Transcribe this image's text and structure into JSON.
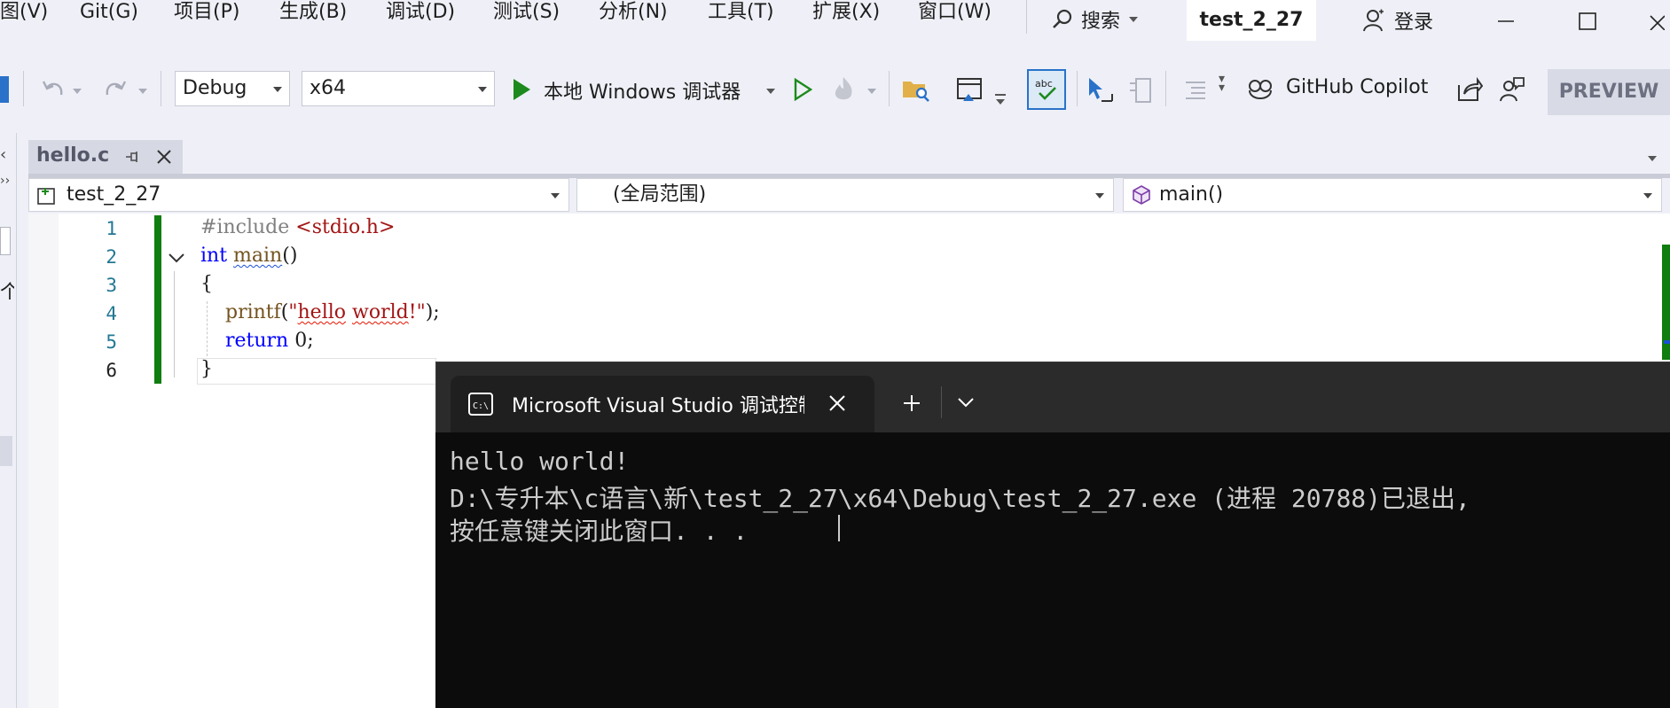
{
  "menu": {
    "items": [
      "图(V)",
      "Git(G)",
      "项目(P)",
      "生成(B)",
      "调试(D)",
      "测试(S)",
      "分析(N)",
      "工具(T)",
      "扩展(X)",
      "窗口(W)"
    ],
    "search_label": "搜索",
    "solution_title": "test_2_27",
    "login_label": "登录"
  },
  "toolbar": {
    "config": "Debug",
    "platform": "x64",
    "debugger_label": "本地 Windows 调试器",
    "copilot_label": "GitHub Copilot",
    "preview_label": "PREVIEW"
  },
  "tabs": [
    {
      "label": "hello.c",
      "active": true
    }
  ],
  "navbar": {
    "project": "test_2_27",
    "scope": "(全局范围)",
    "member": "main()"
  },
  "editor": {
    "line_numbers": [
      "1",
      "2",
      "3",
      "4",
      "5",
      "6"
    ],
    "current_line": "6"
  },
  "terminal": {
    "tab_title": "Microsoft Visual Studio 调试控制台",
    "lines": [
      "hello world!",
      "D:\\专升本\\c语言\\新\\test_2_27\\x64\\Debug\\test_2_27.exe (进程 20788)已退出,",
      "按任意键关闭此窗口. . ."
    ]
  },
  "colors": {
    "accent_green": "#0f7d0f",
    "keyword_blue": "#0000ff",
    "string_red": "#a31515",
    "terminal_bg": "#0c0c0c"
  },
  "icons": [
    "search-icon",
    "person-icon",
    "minimize-icon",
    "maximize-icon",
    "close-icon",
    "undo-icon",
    "redo-icon",
    "play-icon",
    "play-outline-icon",
    "hot-reload-icon",
    "folder-search-icon",
    "home-window-icon",
    "spellcheck-icon",
    "cursor-select-icon",
    "copilot-icon",
    "share-icon",
    "feedback-icon",
    "pin-icon",
    "tab-close-icon",
    "project-icon",
    "cube-icon",
    "chevron-down-icon",
    "terminal-icon",
    "plus-icon"
  ]
}
